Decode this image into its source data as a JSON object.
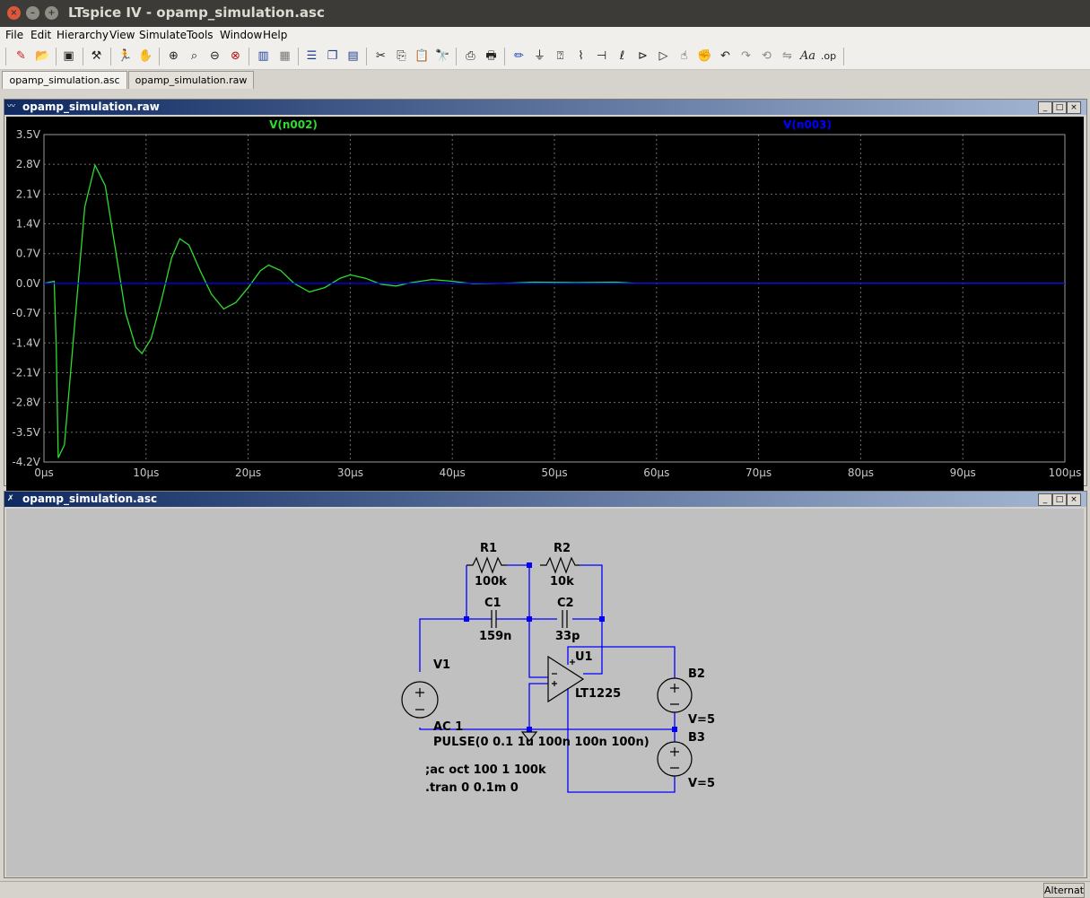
{
  "window": {
    "title": "LTspice IV - opamp_simulation.asc",
    "close_label": "×",
    "min_label": "–",
    "max_label": "+"
  },
  "menu": [
    "File",
    "Edit",
    "Hierarchy",
    "View",
    "Simulate",
    "Tools",
    "Window",
    "Help"
  ],
  "toolbar": [
    "new-schematic-icon",
    "open-icon",
    "save-icon",
    "control-panel-icon",
    "run-icon",
    "pan-icon",
    "zoom-in-icon",
    "zoom-area-icon",
    "zoom-out-icon",
    "zoom-fit-icon",
    "autorange-icon",
    "grid-icon",
    "tile-horizontal-icon",
    "cascade-icon",
    "tile-vertical-icon",
    "cut-icon",
    "copy-icon",
    "paste-icon",
    "find-icon",
    "print-preview-icon",
    "print-icon",
    "wire-icon",
    "ground-icon",
    "label-icon",
    "resistor-icon",
    "capacitor-icon",
    "inductor-icon",
    "diode-icon",
    "component-icon",
    "move-icon",
    "drag-icon",
    "undo-icon",
    "redo-icon",
    "rotate-icon",
    "mirror-icon",
    "text-icon",
    "spice-directive-icon"
  ],
  "tabs": [
    {
      "label": "opamp_simulation.asc",
      "active": true
    },
    {
      "label": "opamp_simulation.raw",
      "active": false
    }
  ],
  "waveform_window": {
    "title": "opamp_simulation.raw",
    "trace_labels": [
      {
        "name": "V(n002)",
        "color": "#2edc2e"
      },
      {
        "name": "V(n003)",
        "color": "#0000ff"
      }
    ]
  },
  "chart_data": {
    "type": "line",
    "xlabel": "",
    "ylabel": "",
    "x_ticks": [
      "0µs",
      "10µs",
      "20µs",
      "30µs",
      "40µs",
      "50µs",
      "60µs",
      "70µs",
      "80µs",
      "90µs",
      "100µs"
    ],
    "y_ticks": [
      "3.5V",
      "2.8V",
      "2.1V",
      "1.4V",
      "0.7V",
      "0.0V",
      "-0.7V",
      "-1.4V",
      "-2.1V",
      "-2.8V",
      "-3.5V",
      "-4.2V"
    ],
    "xlim": [
      0,
      100
    ],
    "ylim": [
      -4.2,
      3.5
    ],
    "grid": true,
    "background": "#000000",
    "series": [
      {
        "name": "V(n002)",
        "color": "#2edc2e",
        "points": [
          [
            0,
            0.0
          ],
          [
            1.0,
            0.05
          ],
          [
            1.2,
            -1.5
          ],
          [
            1.4,
            -4.1
          ],
          [
            2.0,
            -3.8
          ],
          [
            3.0,
            -1.0
          ],
          [
            4.0,
            1.8
          ],
          [
            5.0,
            2.78
          ],
          [
            6.0,
            2.3
          ],
          [
            7.0,
            0.8
          ],
          [
            8.0,
            -0.7
          ],
          [
            9.0,
            -1.5
          ],
          [
            9.6,
            -1.65
          ],
          [
            10.5,
            -1.3
          ],
          [
            11.5,
            -0.4
          ],
          [
            12.5,
            0.6
          ],
          [
            13.3,
            1.05
          ],
          [
            14.2,
            0.9
          ],
          [
            15.3,
            0.3
          ],
          [
            16.4,
            -0.25
          ],
          [
            17.6,
            -0.6
          ],
          [
            18.8,
            -0.45
          ],
          [
            20.0,
            -0.1
          ],
          [
            21.2,
            0.3
          ],
          [
            22.0,
            0.43
          ],
          [
            23.2,
            0.3
          ],
          [
            24.5,
            0.0
          ],
          [
            26.0,
            -0.2
          ],
          [
            27.5,
            -0.1
          ],
          [
            29.0,
            0.12
          ],
          [
            30.0,
            0.2
          ],
          [
            31.5,
            0.12
          ],
          [
            33.0,
            -0.02
          ],
          [
            34.5,
            -0.06
          ],
          [
            36.0,
            0.02
          ],
          [
            38.0,
            0.09
          ],
          [
            40.0,
            0.05
          ],
          [
            42.0,
            -0.01
          ],
          [
            45.0,
            0.0
          ],
          [
            48.0,
            0.03
          ],
          [
            52.0,
            0.02
          ],
          [
            56.0,
            0.03
          ],
          [
            58.0,
            0.0
          ],
          [
            100,
            0.0
          ]
        ]
      },
      {
        "name": "V(n003)",
        "color": "#0000ff",
        "points": [
          [
            0,
            0.0
          ],
          [
            100,
            0.0
          ]
        ]
      }
    ]
  },
  "schematic_window": {
    "title": "opamp_simulation.asc",
    "components": {
      "R1": {
        "name": "R1",
        "value": "100k"
      },
      "R2": {
        "name": "R2",
        "value": "10k"
      },
      "C1": {
        "name": "C1",
        "value": "159n"
      },
      "C2": {
        "name": "C2",
        "value": "33p"
      },
      "U1": {
        "name": "U1",
        "value": "LT1225"
      },
      "V1": {
        "name": "V1",
        "value_line1": "AC 1",
        "value_line2": "PULSE(0 0.1 1u 100n 100n 100n)"
      },
      "B2": {
        "name": "B2",
        "value": "V=5"
      },
      "B3": {
        "name": "B3",
        "value": "V=5"
      }
    },
    "directives": [
      ";ac oct 100 1 100k",
      ".tran 0 0.1m 0"
    ]
  },
  "status": {
    "text": "Alternate"
  }
}
